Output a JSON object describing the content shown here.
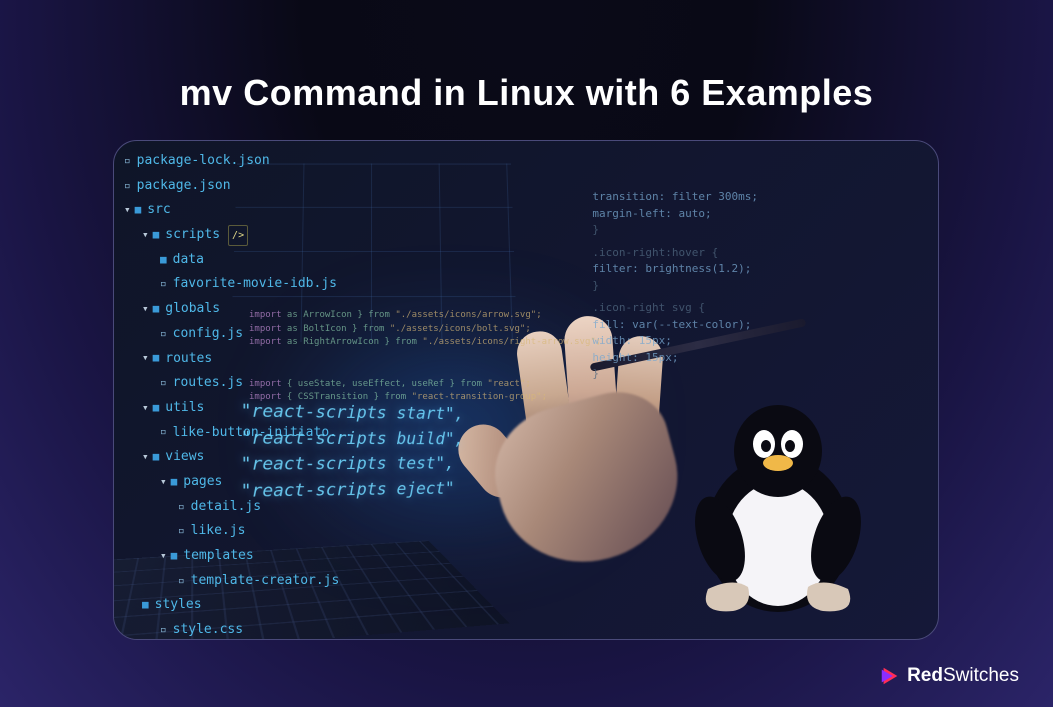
{
  "title": "mv Command in Linux with 6 Examples",
  "logo": {
    "brand_part1": "Red",
    "brand_part2": "Switches"
  },
  "tree": {
    "items": [
      {
        "indent": "i1",
        "icon": "file",
        "name": "package-lock.json"
      },
      {
        "indent": "i1",
        "icon": "file",
        "name": "package.json"
      },
      {
        "indent": "i1",
        "icon": "folder",
        "chev": "▾",
        "name": "src"
      },
      {
        "indent": "i2",
        "icon": "folder",
        "chev": "▾",
        "name": "scripts",
        "tag": "/>"
      },
      {
        "indent": "i3",
        "icon": "folder",
        "chev": "",
        "name": "data"
      },
      {
        "indent": "i3",
        "icon": "file",
        "name": "favorite-movie-idb.js"
      },
      {
        "indent": "i2",
        "icon": "folder",
        "chev": "▾",
        "name": "globals"
      },
      {
        "indent": "i3",
        "icon": "file",
        "name": "config.js"
      },
      {
        "indent": "i2",
        "icon": "folder",
        "chev": "▾",
        "name": "routes"
      },
      {
        "indent": "i3",
        "icon": "file",
        "name": "routes.js"
      },
      {
        "indent": "i2",
        "icon": "folder",
        "chev": "▾",
        "name": "utils"
      },
      {
        "indent": "i3",
        "icon": "file",
        "name": "like-button-initiato..."
      },
      {
        "indent": "i2",
        "icon": "folder",
        "chev": "▾",
        "name": "views"
      },
      {
        "indent": "i3",
        "icon": "folder",
        "chev": "▾",
        "name": "pages"
      },
      {
        "indent": "i4",
        "icon": "file",
        "name": "detail.js"
      },
      {
        "indent": "i4",
        "icon": "file",
        "name": "like.js"
      },
      {
        "indent": "i3",
        "icon": "folder",
        "chev": "▾",
        "name": "templates"
      },
      {
        "indent": "i4",
        "icon": "file",
        "name": "template-creator.js"
      },
      {
        "indent": "i2",
        "icon": "folder",
        "chev": "",
        "name": "styles"
      },
      {
        "indent": "i3",
        "icon": "file",
        "name": "style.css"
      }
    ]
  },
  "big_code": {
    "l1": "\"react-scripts start\",",
    "l2": "\"react-scripts build\",",
    "l3": "\"react-scripts test\",",
    "l4": "\"react-scripts eject\""
  },
  "imports": {
    "l1a": "import",
    "l1b": " as ArrowIcon } from ",
    "l1c": "\"./assets/icons/arrow.svg\";",
    "l2a": "import",
    "l2b": " as BoltIcon } from ",
    "l2c": "\"./assets/icons/bolt.svg\";",
    "l3a": "import",
    "l3b": " as RightArrowIcon } from ",
    "l3c": "\"./assets/icons/right-arrow.svg\";",
    "l4a": "import",
    "l4b": " { useState, useEffect, useRef } from ",
    "l4c": "\"react\";",
    "l5a": "import",
    "l5b": " { CSSTransition } from ",
    "l5c": "\"react-transition-group\";"
  },
  "right_code": {
    "l1": "transition: filter 300ms;",
    "l2": "margin-left: auto;",
    "l3": "}",
    "l4": ".icon-right:hover {",
    "l5": "  filter: brightness(1.2);",
    "l6": "}",
    "l7": ".icon-right svg {",
    "l8": "  fill: var(--text-color);",
    "l9": "  width: 15px;",
    "l10": "  height: 15px;",
    "l11": "}"
  }
}
